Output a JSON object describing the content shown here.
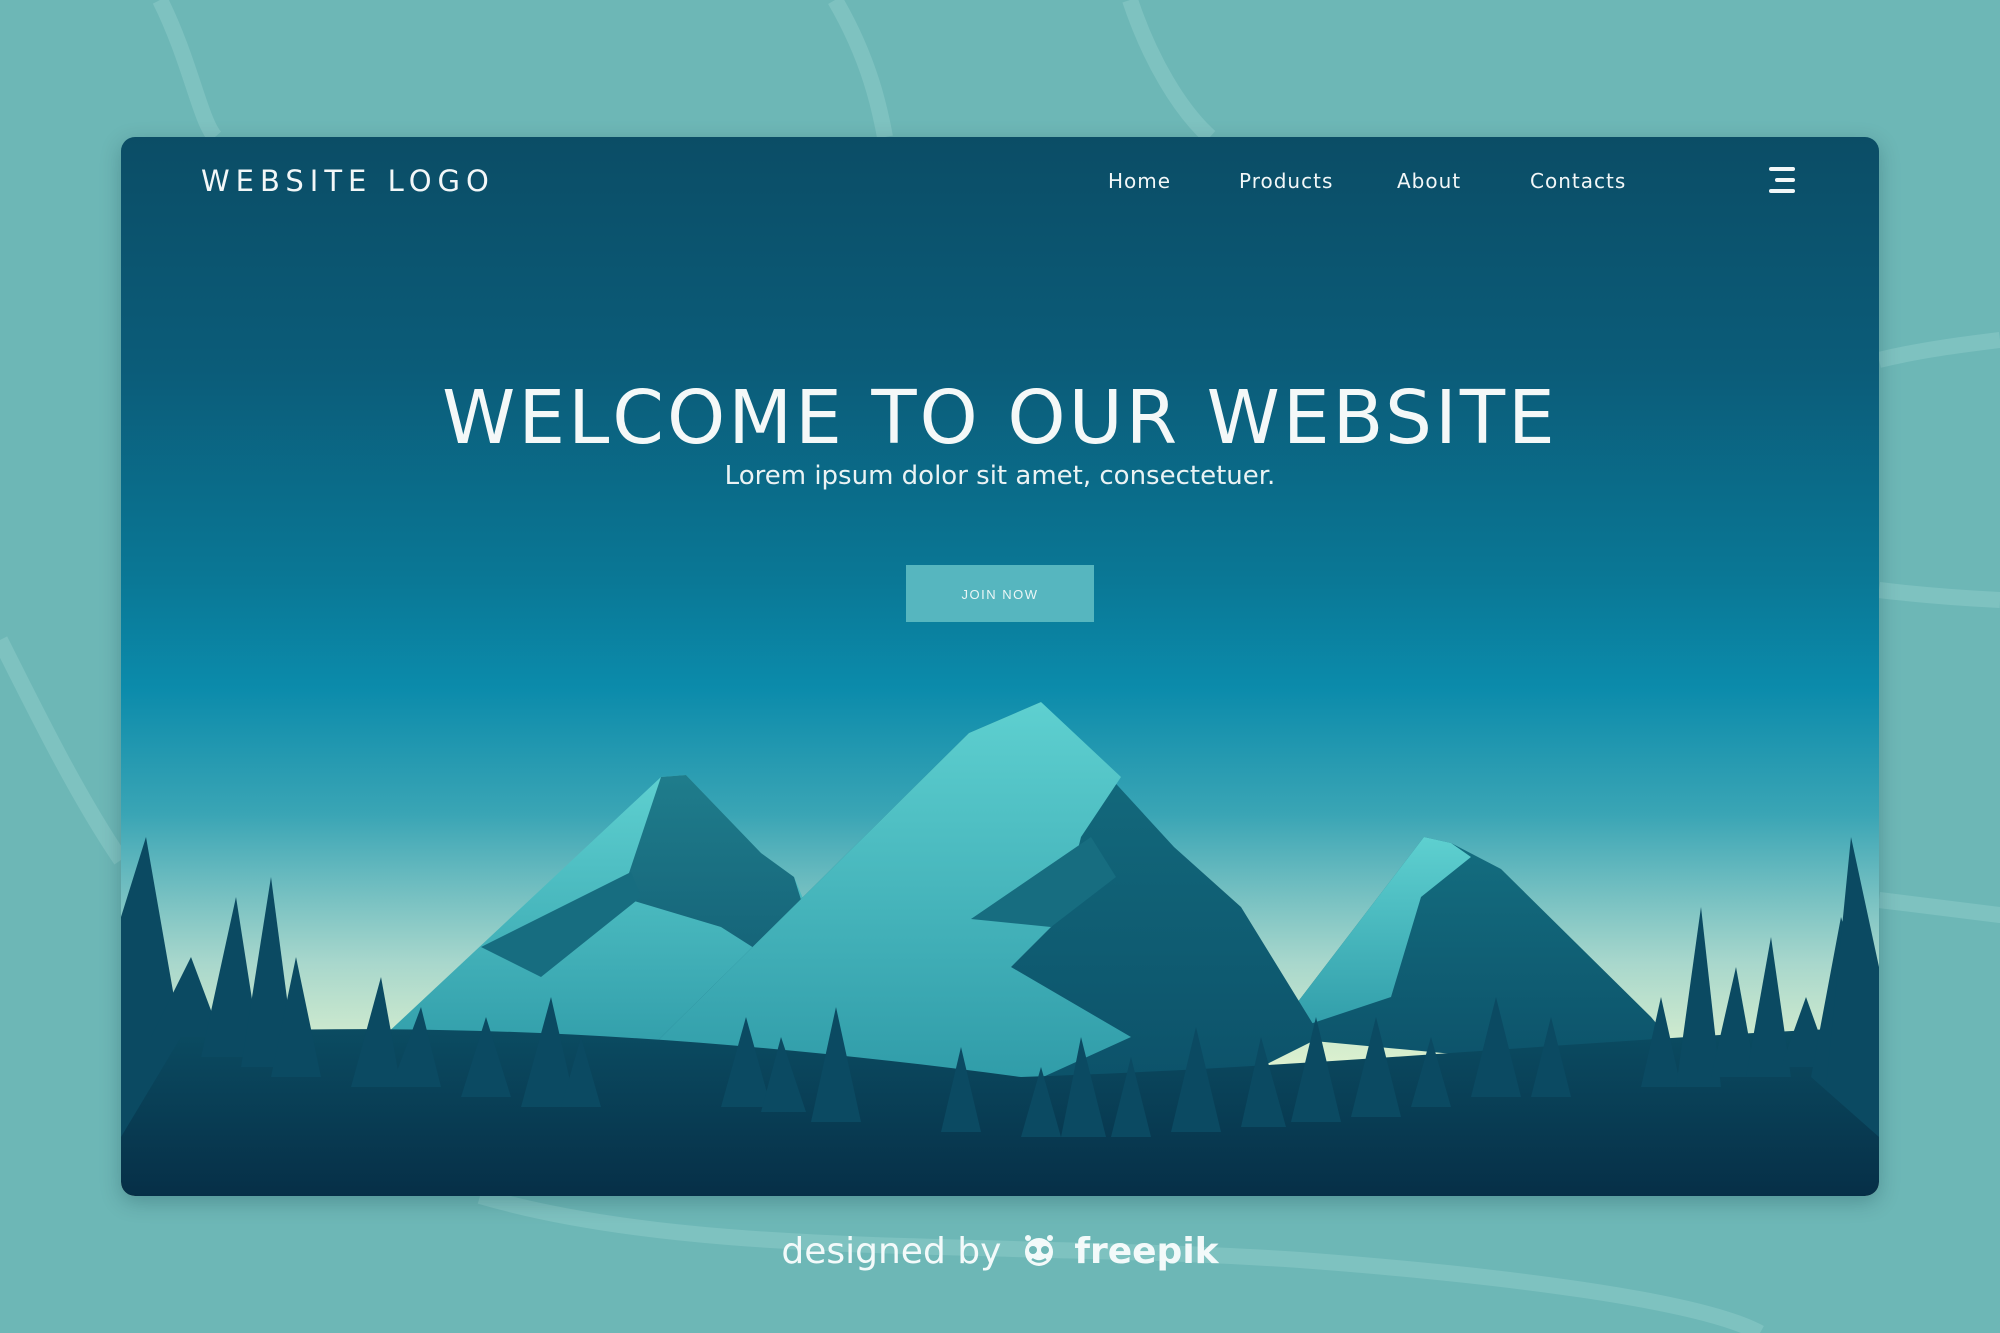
{
  "nav": {
    "logo": "WEBSITE  LOGO",
    "links": [
      "Home",
      "Products",
      "About",
      "Contacts"
    ]
  },
  "hero": {
    "title": "WELCOME TO OUR WEBSITE",
    "subtitle": "Lorem ipsum dolor sit amet, consectetuer.",
    "button": "JOIN NOW"
  },
  "footer": {
    "prefix": "designed by",
    "brand": "freepik"
  },
  "colors": {
    "page_background": "#6db7b6",
    "sky_top": "#0b4d66",
    "sky_horizon": "#dff2cf",
    "mountain": "#4cc2c4",
    "forest": "#0b3f57",
    "button": "#56b6bf"
  },
  "icons": [
    "hamburger-menu-icon",
    "freepik-logo-icon"
  ]
}
